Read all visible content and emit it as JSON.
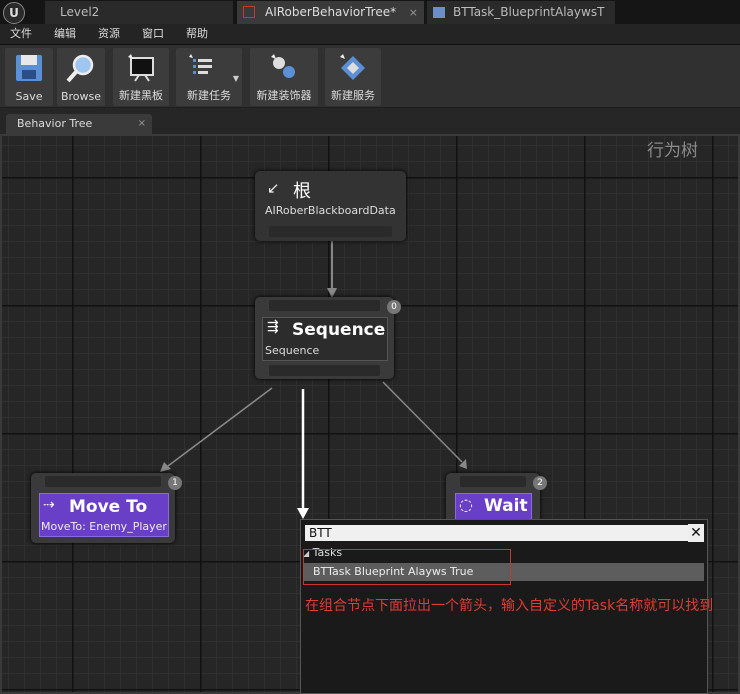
{
  "title_bar": {
    "logo": "unreal-logo",
    "tabs": [
      {
        "label": "Level2",
        "state": "inactive"
      },
      {
        "label": "AIRoberBehaviorTree*",
        "state": "active",
        "icon": "behavior-tree-icon"
      },
      {
        "label": "BTTask_BlueprintAlaywsT",
        "state": "inactive",
        "icon": "blueprint-icon"
      }
    ],
    "close_glyph": "×"
  },
  "menu": [
    "文件",
    "编辑",
    "资源",
    "窗口",
    "帮助"
  ],
  "toolbar": {
    "save": "Save",
    "browse": "Browse",
    "new_blackboard": "新建黑板",
    "new_task": "新建任务",
    "new_decorator": "新建装饰器",
    "new_service": "新建服务"
  },
  "doc_tab": {
    "label": "Behavior Tree",
    "close": "×"
  },
  "graph": {
    "label": "行为树",
    "nodes": {
      "root": {
        "title": "根",
        "subtitle": "AIRoberBlackboardData"
      },
      "sequence": {
        "title": "Sequence",
        "subtitle": "Sequence",
        "badge": "0"
      },
      "move_to": {
        "title": "Move To",
        "subtitle": "MoveTo: Enemy_Player",
        "badge": "1"
      },
      "wait": {
        "title": "Wait",
        "badge": "2"
      }
    }
  },
  "search_popup": {
    "value": "BTT",
    "clear": "✕",
    "category": "Tasks",
    "result": "BTTask Blueprint Alayws True"
  },
  "annotation": "在组合节点下面拉出一个箭头，输入自定义的Task名称就可以找到",
  "colors": {
    "task_purple": "#6a3fc7",
    "annotation_red": "#e03b34"
  }
}
